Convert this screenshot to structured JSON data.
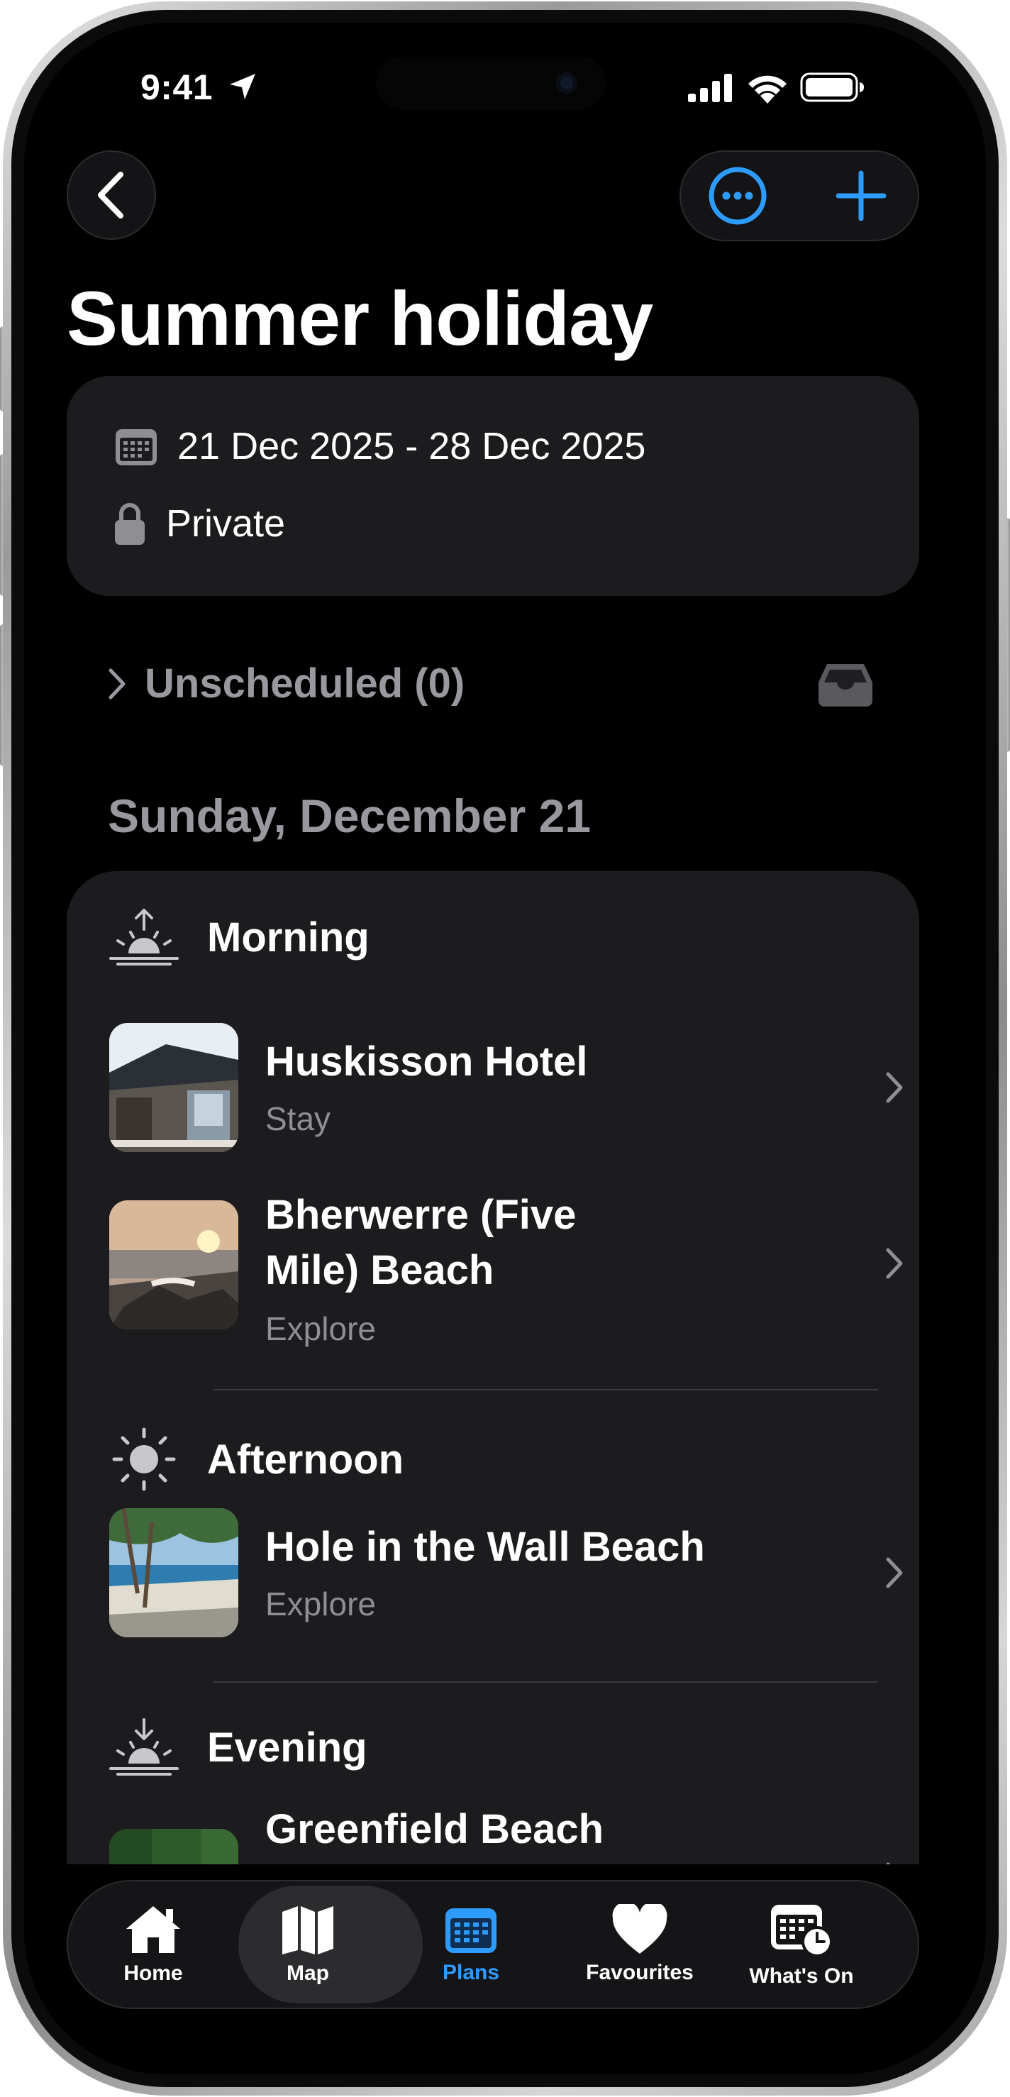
{
  "status_bar": {
    "time": "9:41"
  },
  "header": {
    "back_icon": "chevron-left-icon",
    "more_icon": "ellipsis-circle-icon",
    "add_icon": "plus-icon",
    "title": "Summer holiday"
  },
  "info": {
    "dates": "21 Dec 2025 - 28 Dec 2025",
    "visibility": "Private"
  },
  "unscheduled": {
    "label": "Unscheduled (0)"
  },
  "day": {
    "date_label": "Sunday, December 21",
    "periods": [
      {
        "label": "Morning",
        "icon": "sunrise-icon",
        "items": [
          {
            "name": "Huskisson Hotel",
            "category": "Stay"
          },
          {
            "name": "Bherwerre (Five Mile) Beach",
            "category": "Explore"
          }
        ]
      },
      {
        "label": "Afternoon",
        "icon": "sun-icon",
        "items": [
          {
            "name": "Hole in the Wall Beach",
            "category": "Explore"
          }
        ]
      },
      {
        "label": "Evening",
        "icon": "sunset-icon",
        "items": [
          {
            "name": "Greenfield Beach picnic area",
            "category": ""
          }
        ]
      }
    ]
  },
  "tabbar": {
    "tabs": [
      {
        "label": "Home",
        "icon": "house-icon"
      },
      {
        "label": "Map",
        "icon": "map-icon"
      },
      {
        "label": "Plans",
        "icon": "calendar-icon",
        "active": true
      },
      {
        "label": "Favourites",
        "icon": "heart-icon"
      },
      {
        "label": "What's On",
        "icon": "calendar-clock-icon"
      }
    ]
  },
  "colors": {
    "accent": "#2e9bff",
    "background": "#000000",
    "card": "#1c1c1e",
    "secondary_text": "#8e8e93"
  }
}
